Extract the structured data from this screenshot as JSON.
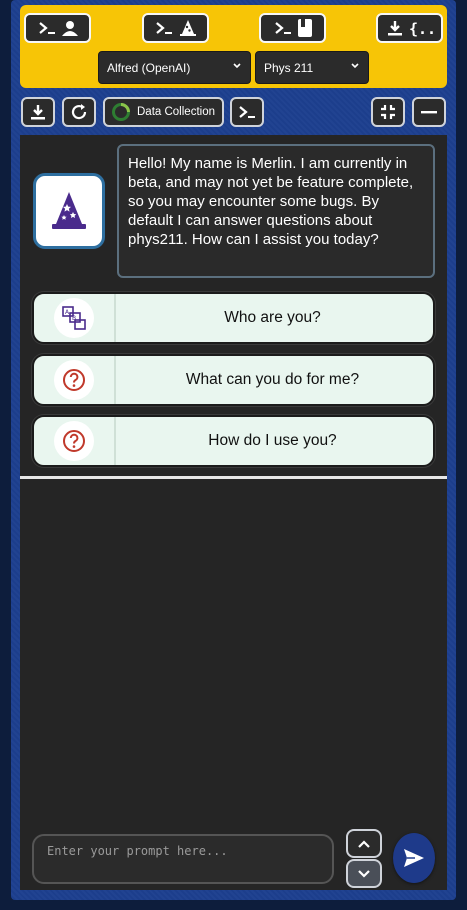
{
  "topbar": {
    "model_select": {
      "value": "Alfred (OpenAI)"
    },
    "course_select": {
      "value": "Phys 211"
    }
  },
  "toolbar": {
    "data_collection_label": "Data Collection"
  },
  "chat": {
    "assistant_message": "Hello! My name is Merlin. I am currently in beta, and may not yet be feature complete, so you may encounter some bugs. By default I can answer questions about phys211. How can I assist you today?",
    "suggestions": [
      {
        "label": "Who are you?",
        "icon": "identity-icon"
      },
      {
        "label": "What can you do for me?",
        "icon": "question-icon"
      },
      {
        "label": "How do I use you?",
        "icon": "question-icon"
      }
    ]
  },
  "input": {
    "placeholder": "Enter your prompt here..."
  },
  "colors": {
    "accent_yellow": "#f7c506",
    "frame_blue": "#1d3f8f",
    "send_blue": "#1e3a8a",
    "wizard_purple": "#4a2b8c",
    "question_red": "#c0392b"
  }
}
